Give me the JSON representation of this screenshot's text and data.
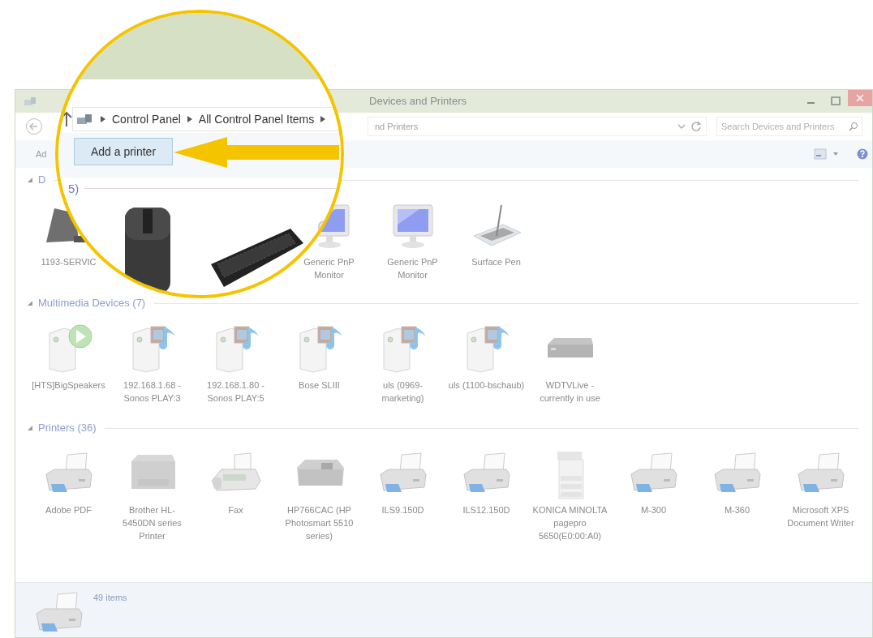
{
  "window": {
    "title": "Devices and Printers"
  },
  "address": {
    "visible_text": "nd Printers"
  },
  "search": {
    "placeholder": "Search Devices and Printers"
  },
  "toolbar": {
    "visible_text": "Ad"
  },
  "sections": [
    {
      "title": "D",
      "expanded": true,
      "items": [
        {
          "kind": "tablet",
          "label": "1193-SERVIC"
        },
        {
          "kind": "covered"
        },
        {
          "kind": "covered"
        },
        {
          "kind": "monitor",
          "label": "Generic PnP Monitor"
        },
        {
          "kind": "monitor",
          "label": "Generic PnP Monitor"
        },
        {
          "kind": "pen",
          "label": "Surface Pen"
        }
      ]
    },
    {
      "title": "Multimedia Devices (7)",
      "expanded": true,
      "items": [
        {
          "kind": "speaker-play",
          "label": "[HTS]BigSpeakers"
        },
        {
          "kind": "speaker-music",
          "label": "192.168.1.68 - Sonos PLAY:3"
        },
        {
          "kind": "speaker-music",
          "label": "192.168.1.80 - Sonos PLAY:5"
        },
        {
          "kind": "speaker-music",
          "label": "Bose SLIII"
        },
        {
          "kind": "speaker-music",
          "label": "uls (0969-marketing)"
        },
        {
          "kind": "speaker-music",
          "label": "uls (1100-bschaub)"
        },
        {
          "kind": "media-box",
          "label": "WDTVLive - currently in use"
        }
      ]
    },
    {
      "title": "Printers (36)",
      "expanded": true,
      "items": [
        {
          "kind": "printer",
          "label": "Adobe PDF"
        },
        {
          "kind": "laser",
          "label": "Brother HL-5450DN series Printer"
        },
        {
          "kind": "fax",
          "label": "Fax"
        },
        {
          "kind": "inkjet",
          "label": "HP766CAC (HP Photosmart 5510 series)"
        },
        {
          "kind": "printer",
          "label": "ILS9.150D"
        },
        {
          "kind": "printer",
          "label": "ILS12.150D"
        },
        {
          "kind": "mfp",
          "label": "KONICA MINOLTA pagepro 5650(E0:00:A0)"
        },
        {
          "kind": "printer",
          "label": "M-300"
        },
        {
          "kind": "printer",
          "label": "M-360"
        },
        {
          "kind": "printer",
          "label": "Microsoft XPS Document Writer"
        }
      ]
    }
  ],
  "status_bar": {
    "count": "49 items"
  },
  "magnifier": {
    "breadcrumb": [
      "Control Panel",
      "All Control Panel Items"
    ],
    "button": "Add a printer",
    "section_text": "5)",
    "devices": [
      {
        "kind": "mouse"
      },
      {
        "kind": "keyboard"
      }
    ]
  }
}
